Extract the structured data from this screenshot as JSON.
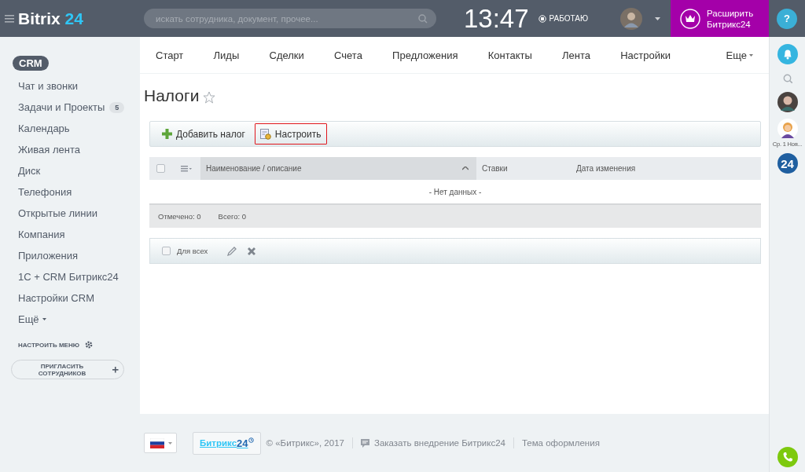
{
  "header": {
    "logo": {
      "name": "Bitrix",
      "number": "24"
    },
    "search": {
      "placeholder": "искать сотрудника, документ, прочее..."
    },
    "clock": "13:47",
    "work_status": "РАБОТАЮ",
    "upgrade": {
      "line1": "Расширить",
      "line2": "Битрикс24"
    },
    "help": "?"
  },
  "sidebar": {
    "items": [
      {
        "label": "CRM",
        "selected": true
      },
      {
        "label": "Чат и звонки",
        "selected": false
      },
      {
        "label": "Задачи и Проекты",
        "counter": "5",
        "selected": false
      },
      {
        "label": "Календарь",
        "selected": false
      },
      {
        "label": "Живая лента",
        "selected": false
      },
      {
        "label": "Диск",
        "selected": false
      },
      {
        "label": "Телефония",
        "selected": false
      },
      {
        "label": "Открытые линии",
        "selected": false
      },
      {
        "label": "Компания",
        "selected": false
      },
      {
        "label": "Приложения",
        "selected": false
      },
      {
        "label": "1С + CRM Битрикс24",
        "selected": false
      },
      {
        "label": "Настройки CRM",
        "selected": false
      },
      {
        "label": "Ещё",
        "selected": false,
        "kind": "more"
      }
    ],
    "configure": "НАСТРОИТЬ МЕНЮ",
    "invite": "ПРИГЛАСИТЬ СОТРУДНИКОВ"
  },
  "tabs": [
    {
      "label": "Старт"
    },
    {
      "label": "Лиды"
    },
    {
      "label": "Сделки"
    },
    {
      "label": "Счета"
    },
    {
      "label": "Предложения"
    },
    {
      "label": "Контакты"
    },
    {
      "label": "Лента"
    },
    {
      "label": "Настройки"
    }
  ],
  "tabs_more": "Еще",
  "page": {
    "title": "Налоги",
    "favorite": false
  },
  "toolbar": [
    {
      "label": "Добавить налог",
      "kind": "add",
      "highlighted": false
    },
    {
      "label": "Настроить",
      "kind": "settings",
      "highlighted": true
    }
  ],
  "grid": {
    "select_all": {
      "checked": false
    },
    "columns": [
      {
        "label": "Наименование / описание",
        "sorted": true
      },
      {
        "label": "Ставки",
        "sorted": false
      },
      {
        "label": "Дата изменения",
        "sorted": false
      }
    ],
    "empty": "- Нет данных -",
    "checked_count": "Отмечено: 0",
    "total": "Всего: 0"
  },
  "actions": {
    "for_all": {
      "label": "Для всех",
      "checked": false
    }
  },
  "footer": {
    "logo": {
      "name": "Битрикс",
      "number": "24"
    },
    "copyright": "© «Битрикс», 2017",
    "order": "Заказать внедрение Битрикс24",
    "theme": "Тема оформления"
  },
  "right_bar": {
    "contact_label": "Ср. 1 Ноя...",
    "badge": "24"
  }
}
